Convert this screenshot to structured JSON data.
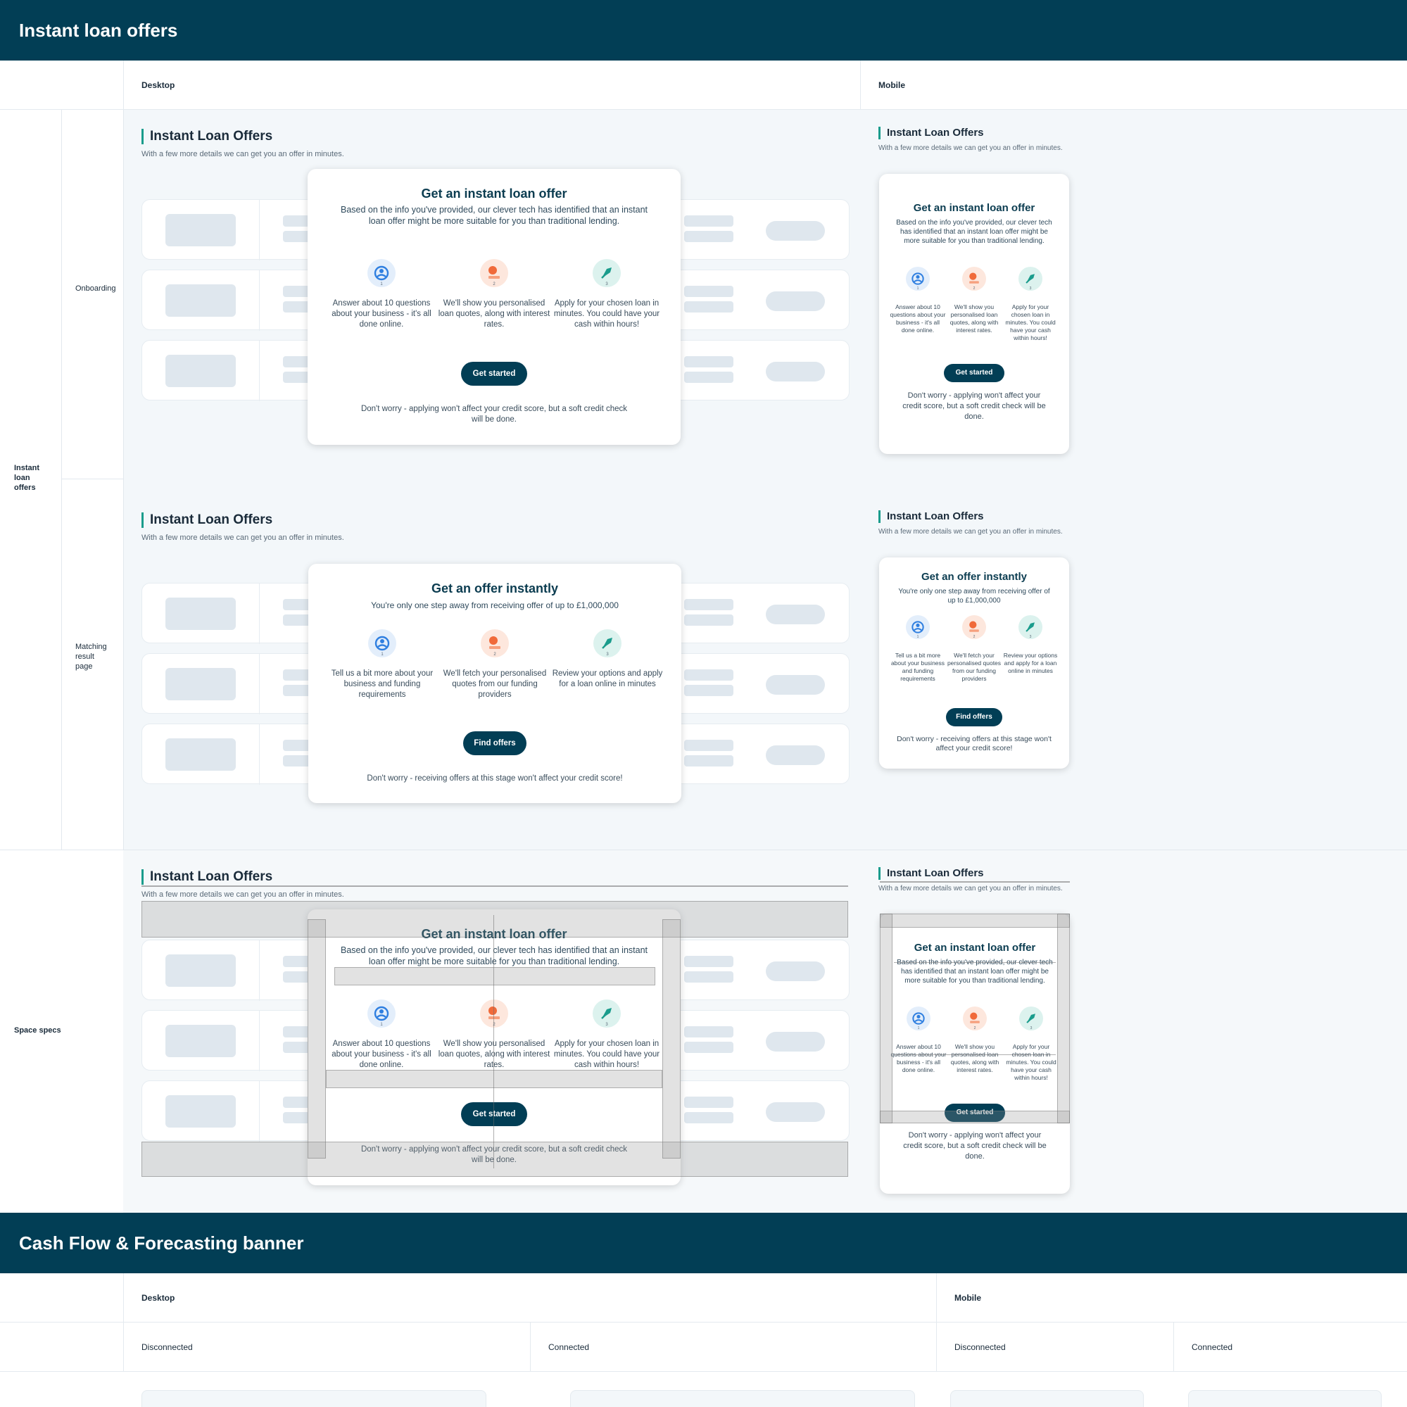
{
  "section1": {
    "title": "Instant loan offers",
    "col_desktop": "Desktop",
    "col_mobile": "Mobile",
    "group_label": "Instant loan offers",
    "row_onboarding": "Onboarding",
    "row_matching": "Matching result page",
    "row_space": "Space specs"
  },
  "page": {
    "title": "Instant Loan Offers",
    "subtitle": "With a few more details we can get you an offer in minutes."
  },
  "modal_a": {
    "title": "Get an instant loan offer",
    "body": "Based on the info you've provided, our clever tech has identified that an instant loan offer might be more suitable for you than traditional lending.",
    "steps": [
      "Answer about 10 questions about your business - it's all done online.",
      "We'll show you personalised loan quotes, along with interest rates.",
      "Apply for your chosen loan in minutes. You could have your cash within hours!"
    ],
    "cta": "Get started",
    "footer": "Don't worry - applying won't affect your credit score, but a soft credit check will be done."
  },
  "modal_b": {
    "title": "Get an offer instantly",
    "body": "You're only one step away from receiving offer of up to £1,000,000",
    "steps": [
      "Tell us a bit more about your business and funding requirements",
      "We'll fetch your personalised quotes from our funding providers",
      "Review your options and apply for a loan online in minutes"
    ],
    "cta": "Find offers",
    "footer": "Don't worry - receiving offers at this stage won't affect your credit score!"
  },
  "step_numbers": [
    "1",
    "2",
    "3"
  ],
  "icons": {
    "step1": "user-circle-icon",
    "step2": "loan-quote-icon",
    "step3": "rocket-icon"
  },
  "colors": {
    "banner": "#023e55",
    "accent": "#1a9c8c",
    "icon_blue": "#2f7fe0",
    "icon_orange": "#f06a3a",
    "icon_teal": "#1a9c8c"
  },
  "section2": {
    "title": "Cash Flow & Forecasting banner",
    "col_desktop": "Desktop",
    "col_mobile": "Mobile",
    "disconnected": "Disconnected",
    "connected": "Connected"
  }
}
